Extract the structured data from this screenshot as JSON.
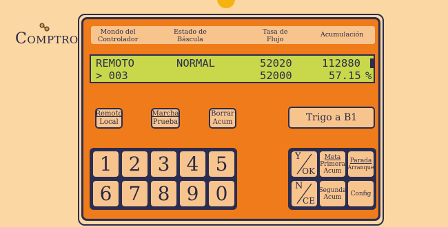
{
  "brand": {
    "logo_initial": "C",
    "logo_rest": "OMPTROL"
  },
  "header": {
    "col1": "Mondo del\nControlador",
    "col2": "Estado de\nBáscula",
    "col3": "Tasa de\nFlujo",
    "col4": "Acumulación"
  },
  "display": {
    "row1": {
      "mode": "REMOTO",
      "status": "NORMAL",
      "rate": "52020",
      "total": "112880"
    },
    "row2": {
      "prompt": "> 003",
      "rate": "52000",
      "total": "57.15",
      "unit": "%"
    }
  },
  "buttons": {
    "remote_local": {
      "top": "Remoto",
      "bottom": "Local"
    },
    "test_run": {
      "top": "Marcha",
      "bottom": "Prueba"
    },
    "clear_acc": {
      "top": "Borrar",
      "bottom": "Acum"
    },
    "product": "Trigo a B1"
  },
  "keypad": [
    "1",
    "2",
    "3",
    "4",
    "5",
    "6",
    "7",
    "8",
    "9",
    "0"
  ],
  "function_keys": {
    "yes_ok": {
      "top": "Y",
      "bottom": "OK"
    },
    "target": {
      "top": "Meta",
      "mid": "Primera",
      "bottom": "Acum"
    },
    "stop_start": {
      "top": "Parada",
      "bottom": "Arranque"
    },
    "no_ce": {
      "top": "N",
      "bottom": "CE"
    },
    "second_acc": {
      "top": "Segunda",
      "bottom": "Acum"
    },
    "config": "Config"
  },
  "colors": {
    "panel": "#ef7b1a",
    "background": "#fbd7a4",
    "lcd": "#c8d84a",
    "ink": "#2a2d50"
  }
}
